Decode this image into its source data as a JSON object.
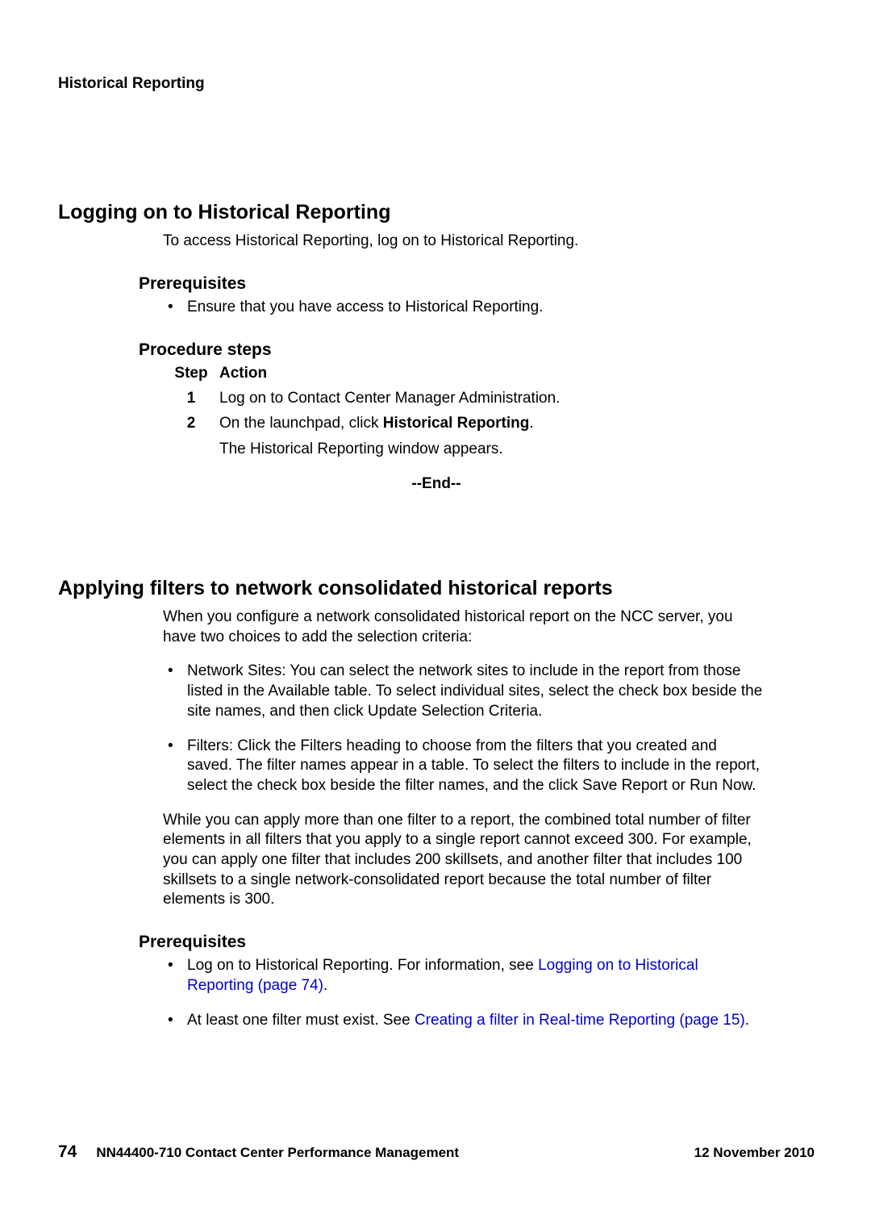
{
  "header": {
    "running_title": "Historical Reporting"
  },
  "section1": {
    "title": "Logging on to Historical Reporting",
    "intro": "To access Historical Reporting, log on to Historical Reporting.",
    "prereq_heading": "Prerequisites",
    "prereq_items": [
      "Ensure that you have access to Historical Reporting."
    ],
    "steps_heading": "Procedure steps",
    "col_step": "Step",
    "col_action": "Action",
    "steps": [
      {
        "num": "1",
        "action_plain": "Log on to Contact Center Manager Administration."
      },
      {
        "num": "2",
        "action_prefix": "On the launchpad, click ",
        "action_bold": "Historical Reporting",
        "action_suffix": "."
      }
    ],
    "step2_note": "The Historical Reporting window appears.",
    "end": "--End--"
  },
  "section2": {
    "title": "Applying filters to network consolidated historical reports",
    "intro": "When you configure a network consolidated historical report on the NCC server, you have two choices to add the selection criteria:",
    "choice_items": [
      "Network Sites: You can select the network sites to include in the report from those listed in the Available table. To select individual sites, select the check box beside the site names, and then click Update Selection Criteria.",
      "Filters: Click the Filters heading to choose from the filters that you created and saved. The filter names appear in a table. To select the filters to include in the report, select the check box beside the filter names, and the click Save Report or Run Now."
    ],
    "para_limit": "While you can apply more than one filter to a report, the combined total number of filter elements in all filters that you apply to a single report cannot exceed 300. For example, you can apply one filter that includes 200 skillsets, and another filter that includes 100 skillsets to a single network-consolidated report because the total number of filter elements is 300.",
    "prereq_heading": "Prerequisites",
    "prereq1_text": "Log on to Historical Reporting. For information, see ",
    "prereq1_link": "Logging on to Historical Reporting (page 74)",
    "prereq1_tail": ".",
    "prereq2_text": "At least one filter must exist. See ",
    "prereq2_link": "Creating a filter in Real-time Reporting (page 15)",
    "prereq2_tail": "."
  },
  "footer": {
    "page_number": "74",
    "doc_id": "NN44400-710 Contact Center Performance Management",
    "date": "12 November 2010"
  }
}
